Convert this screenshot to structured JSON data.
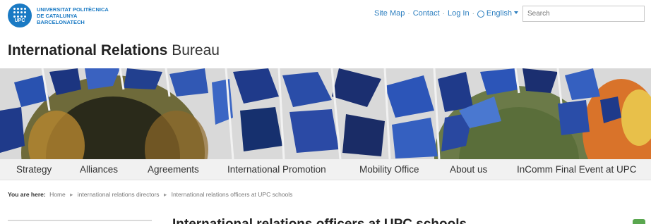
{
  "header": {
    "logo_text": "UPC",
    "university_line1": "UNIVERSITAT POLITÈCNICA",
    "university_line2": "DE CATALUNYA",
    "university_line3_a": "BARCELONA",
    "university_line3_b": "TECH",
    "links": {
      "site_map": "Site Map",
      "contact": "Contact",
      "login": "Log In",
      "language": "English"
    },
    "search_placeholder": "Search"
  },
  "site_title": {
    "strong": "International Relations",
    "light": "Bureau"
  },
  "nav": {
    "items": [
      "Strategy",
      "Alliances",
      "Agreements",
      "International Promotion",
      "Mobility Office",
      "About us",
      "InComm Final Event at UPC"
    ]
  },
  "breadcrumb": {
    "lead": "You are here:",
    "items": [
      "Home",
      "international relations directors",
      "International relations officers at UPC schools"
    ]
  },
  "main": {
    "heading": "International relations officers at UPC schools"
  },
  "colors": {
    "brand_blue": "#1a7ac4",
    "link_blue": "#2d7fc0",
    "nav_bg": "#f1f1f1",
    "green_button": "#5aa74f"
  }
}
